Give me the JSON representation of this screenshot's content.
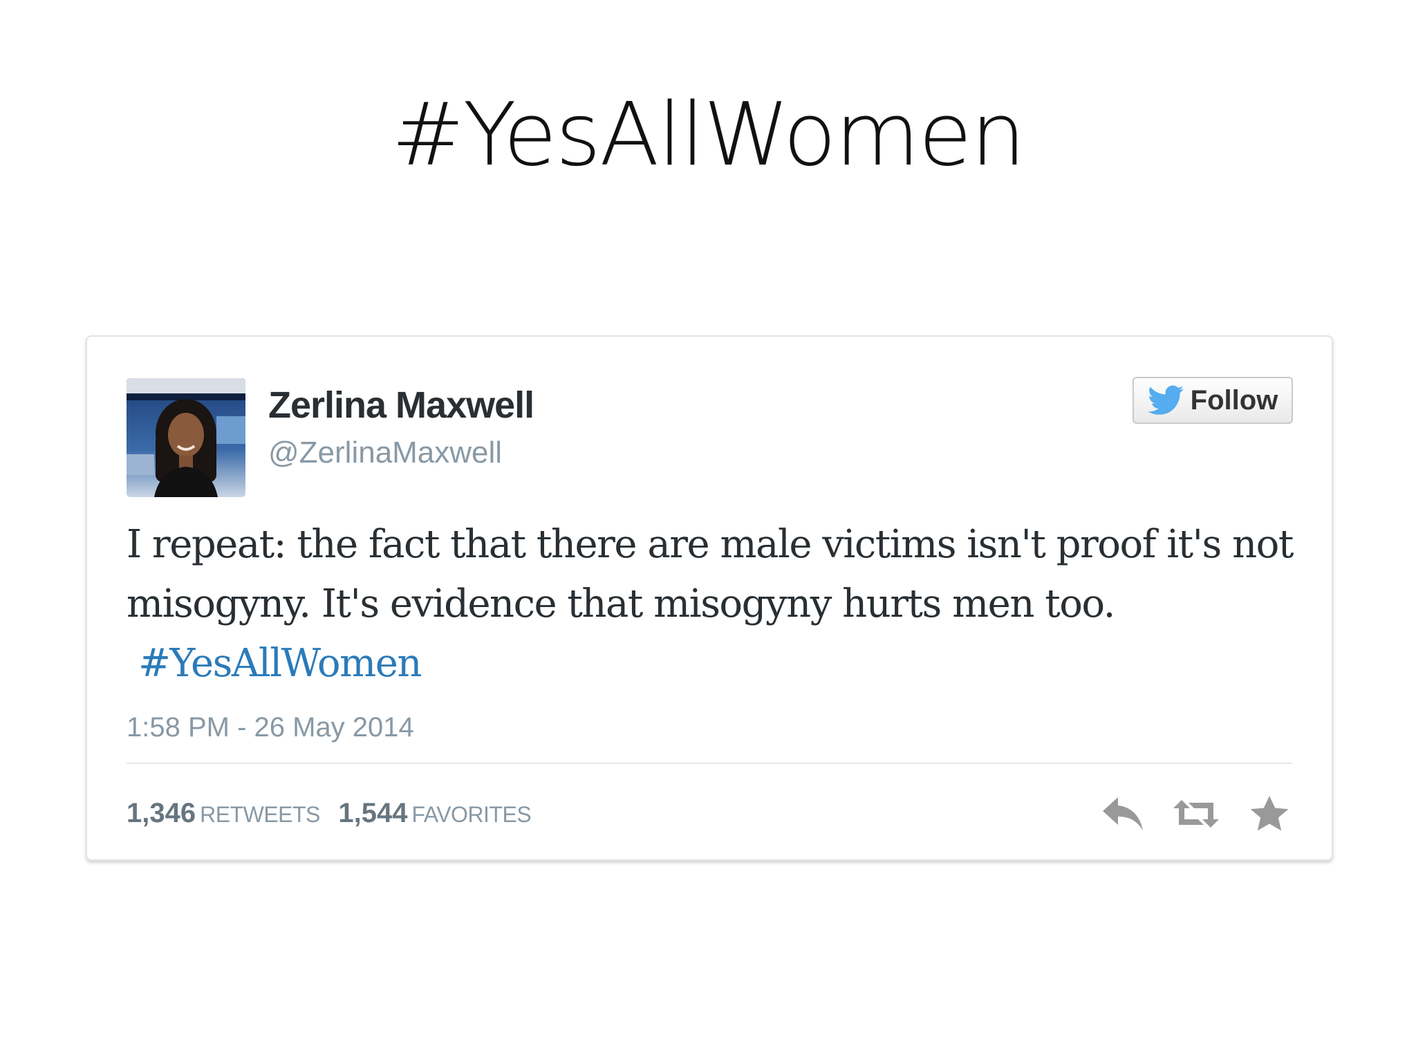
{
  "slide": {
    "title": "#YesAllWomen"
  },
  "tweet": {
    "display_name": "Zerlina Maxwell",
    "handle": "@ZerlinaMaxwell",
    "follow_label": "Follow",
    "text": "I repeat: the fact that there are male victims isn't proof it's not misogyny. It's evidence that misogyny hurts men too.",
    "hashtag": "#YesAllWomen",
    "timestamp": "1:58 PM - 26 May 2014",
    "retweets_count": "1,346",
    "retweets_label": "RETWEETS",
    "favorites_count": "1,544",
    "favorites_label": "FAVORITES"
  },
  "colors": {
    "link": "#2b7bb9",
    "twitter_bird": "#55acee",
    "action_icons": "#999999"
  },
  "icons": [
    "twitter-bird-icon",
    "reply-icon",
    "retweet-icon",
    "favorite-star-icon"
  ]
}
